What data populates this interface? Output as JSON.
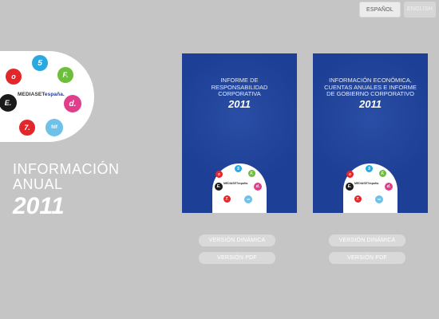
{
  "language": {
    "active": "ESPAÑOL",
    "inactive": "ENGLISH"
  },
  "brand": {
    "name_prefix": "MEDIASET",
    "name_suffix": "españa.",
    "channels": [
      "5",
      "F.",
      "d.",
      "fdf",
      "7.",
      "E.",
      "o"
    ],
    "colors": {
      "navy": "#1d3f95",
      "red": "#e3262b",
      "cyan": "#29a9e0",
      "green": "#6cbf3b",
      "magenta": "#e03e8b",
      "black": "#1b1b1b"
    }
  },
  "main_title": {
    "line1": "INFORMACIÓN",
    "line2": "ANUAL",
    "year": "2011"
  },
  "reports": [
    {
      "title_lines": [
        "INFORME DE",
        "RESPONSABILIDAD",
        "CORPORATIVA"
      ],
      "year": "2011",
      "mini_brand": "MEDIASETespaña.",
      "buttons": {
        "dynamic": "VERSIÓN DINÁMICA",
        "pdf": "VERSIÓN PDF"
      }
    },
    {
      "title_lines": [
        "INFORMACIÓN ECONÓMICA,",
        "CUENTAS ANUALES E INFORME",
        "DE GOBIERNO CORPORATIVO"
      ],
      "year": "2011",
      "mini_brand": "MEDIASETespaña.",
      "buttons": {
        "dynamic": "VERSIÓN DINÁMICA",
        "pdf": "VERSIÓN PDF"
      }
    }
  ]
}
